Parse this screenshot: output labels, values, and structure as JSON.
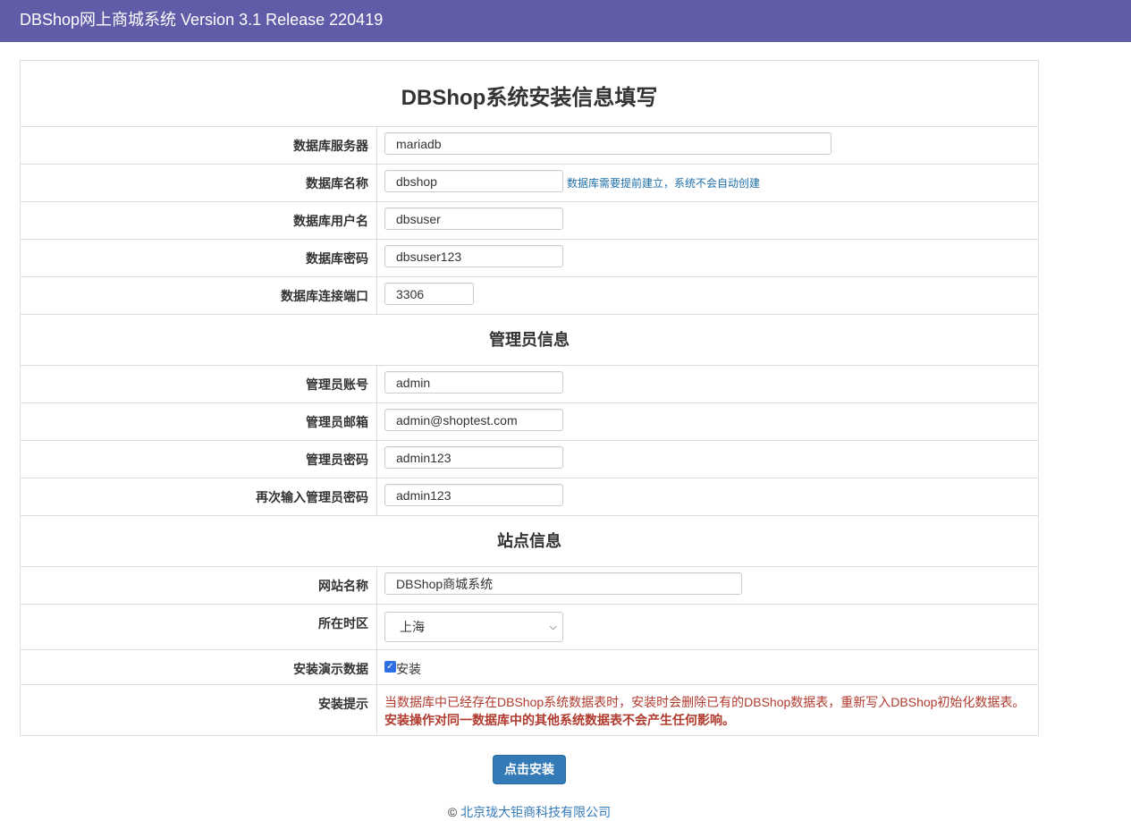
{
  "header": {
    "title": "DBShop网上商城系统 Version 3.1 Release 220419"
  },
  "page_title": "DBShop系统安装信息填写",
  "database": {
    "server_label": "数据库服务器",
    "server_value": "mariadb",
    "name_label": "数据库名称",
    "name_value": "dbshop",
    "name_help": "数据库需要提前建立，系统不会自动创建",
    "user_label": "数据库用户名",
    "user_value": "dbsuser",
    "password_label": "数据库密码",
    "password_value": "dbsuser123",
    "port_label": "数据库连接端口",
    "port_value": "3306"
  },
  "admin": {
    "section_title": "管理员信息",
    "account_label": "管理员账号",
    "account_value": "admin",
    "email_label": "管理员邮箱",
    "email_value": "admin@shoptest.com",
    "password_label": "管理员密码",
    "password_value": "admin123",
    "password2_label": "再次输入管理员密码",
    "password2_value": "admin123"
  },
  "site": {
    "section_title": "站点信息",
    "name_label": "网站名称",
    "name_value": "DBShop商城系统",
    "timezone_label": "所在时区",
    "timezone_value": "上海",
    "demo_label": "安装演示数据",
    "demo_checkbox_label": "安装",
    "demo_checked": true,
    "hint_label": "安装提示",
    "hint_line1": "当数据库中已经存在DBShop系统数据表时，安装时会删除已有的DBShop数据表，重新写入DBShop初始化数据表。",
    "hint_line2": "安装操作对同一数据库中的其他系统数据表不会产生任何影响。"
  },
  "install_button": "点击安装",
  "footer": {
    "copyright": "©",
    "company": "北京珑大钜商科技有限公司"
  },
  "colors": {
    "topbar": "#615ca8",
    "button": "#337ab7",
    "warning": "#b03a2e",
    "help": "#1f6fa8"
  }
}
